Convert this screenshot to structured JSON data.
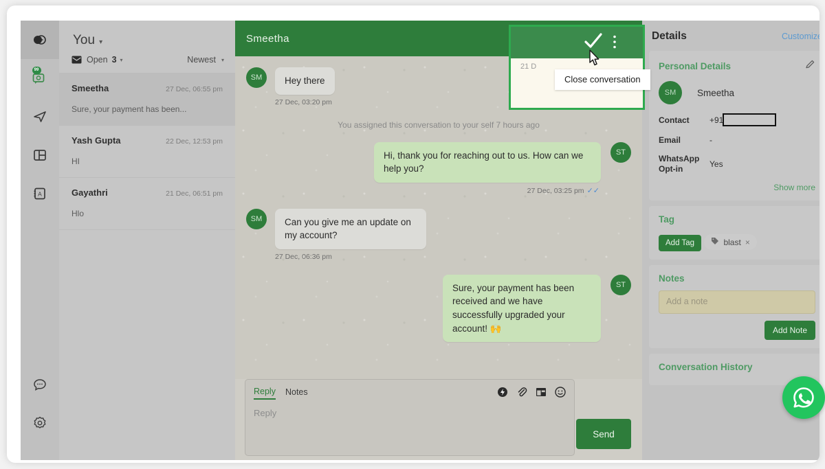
{
  "rail": {
    "items": [
      {
        "name": "contacts-toggle-icon",
        "icon": "contrast-circle",
        "badge": "",
        "active": true
      },
      {
        "name": "inbox-icon",
        "icon": "chat-inbox",
        "badge": "99",
        "active": false
      },
      {
        "name": "broadcast-icon",
        "icon": "paper-plane",
        "badge": "",
        "active": false
      },
      {
        "name": "dashboard-icon",
        "icon": "layout-panels",
        "badge": "",
        "active": false
      },
      {
        "name": "contact-book-icon",
        "icon": "address-book",
        "badge": "",
        "active": false
      }
    ],
    "bottom": [
      {
        "name": "help-chat-icon",
        "icon": "chat-dots"
      },
      {
        "name": "settings-icon",
        "icon": "gear"
      }
    ]
  },
  "inbox": {
    "owner_label": "You",
    "owner_caret": "▾",
    "status_label": "Open",
    "status_count": "3",
    "status_caret": "▾",
    "sort_label": "Newest",
    "sort_caret": "▾",
    "conversations": [
      {
        "name": "Smeetha",
        "time": "27 Dec, 06:55 pm",
        "snippet": "Sure, your payment has been...",
        "selected": true
      },
      {
        "name": "Yash Gupta",
        "time": "22 Dec, 12:53 pm",
        "snippet": "HI",
        "selected": false
      },
      {
        "name": "Gayathri",
        "time": "21 Dec, 06:51 pm",
        "snippet": "Hlo",
        "selected": false
      }
    ]
  },
  "chat": {
    "title": "Smeetha",
    "messages": [
      {
        "kind": "message",
        "direction": "in",
        "avatar": "SM",
        "text": "Hey there",
        "time": "27 Dec, 03:20 pm",
        "ticks": ""
      },
      {
        "kind": "system",
        "text": "You assigned this conversation to your self 7 hours ago"
      },
      {
        "kind": "message",
        "direction": "out",
        "avatar": "ST",
        "text": "Hi, thank you for reaching out to us. How can we help you?",
        "time": "27 Dec, 03:25 pm",
        "ticks": "✓✓"
      },
      {
        "kind": "message",
        "direction": "in",
        "avatar": "SM",
        "text": "Can you give me an update on my account?",
        "time": "27 Dec, 06:36 pm",
        "ticks": ""
      },
      {
        "kind": "message",
        "direction": "out",
        "avatar": "ST",
        "text": "Sure, your payment has been received and we have successfully upgraded your account! 🙌",
        "time": "",
        "ticks": ""
      }
    ],
    "composer": {
      "tab_reply": "Reply",
      "tab_notes": "Notes",
      "input_placeholder": "Reply",
      "send_label": "Send",
      "icons": [
        {
          "name": "quick-reply-icon",
          "glyph": "lightning-badge"
        },
        {
          "name": "attachment-icon",
          "glyph": "paperclip"
        },
        {
          "name": "template-icon",
          "glyph": "template-grid"
        },
        {
          "name": "emoji-icon",
          "glyph": "smiley"
        }
      ]
    }
  },
  "highlight": {
    "tooltip_text": "Close conversation",
    "masked_date": "21 D",
    "close-conversation-icon": "check",
    "more-options-icon": "kebab",
    "border_color": "#2eaa4e"
  },
  "details": {
    "title": "Details",
    "customize_label": "Customize",
    "personal": {
      "section_title": "Personal Details",
      "edit_icon": "pencil-icon",
      "avatar_initials": "SM",
      "name": "Smeetha",
      "fields": [
        {
          "label": "Contact",
          "value": "+91",
          "redacted": true
        },
        {
          "label": "Email",
          "value": "-",
          "redacted": false
        },
        {
          "label": "WhatsApp Opt-in",
          "value": "Yes",
          "redacted": false
        }
      ],
      "show_more_label": "Show more"
    },
    "tag": {
      "section_title": "Tag",
      "add_tag_label": "Add Tag",
      "chips": [
        {
          "label": "blast",
          "close": "×"
        }
      ]
    },
    "notes": {
      "section_title": "Notes",
      "placeholder": "Add a note",
      "add_note_label": "Add Note"
    },
    "history": {
      "section_title": "Conversation History"
    }
  },
  "fab": {
    "name": "whatsapp-fab",
    "icon": "whatsapp"
  },
  "colors": {
    "brand_green": "#2e7d3b",
    "highlight_green": "#2eaa4e",
    "link_blue": "#5b9ad1",
    "whatsapp_green": "#22c55e",
    "note_yellow": "#cfc9a7"
  }
}
